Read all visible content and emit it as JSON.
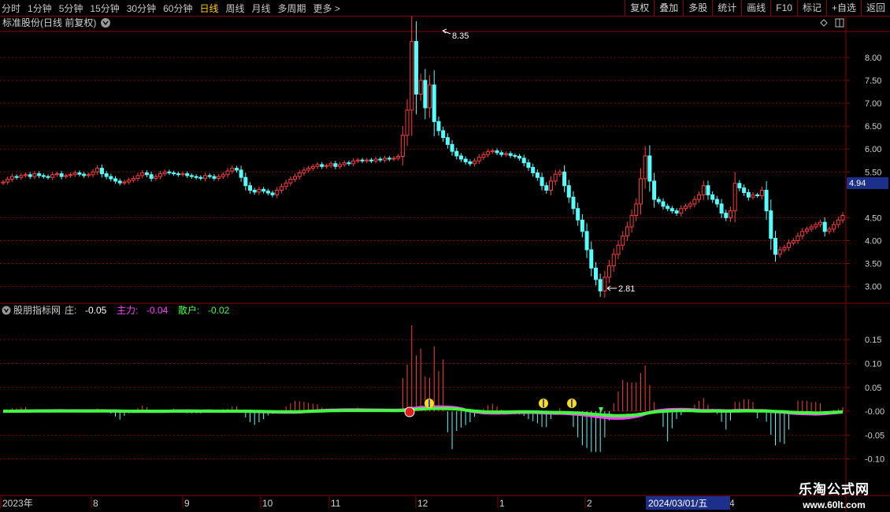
{
  "toolbar": {
    "periods": [
      "分时",
      "1分钟",
      "5分钟",
      "15分钟",
      "30分钟",
      "60分钟",
      "日线",
      "周线",
      "月线",
      "多周期",
      "更多 >"
    ],
    "active_period": "日线",
    "actions": [
      "复权",
      "叠加",
      "多股",
      "统计",
      "画线",
      "F10",
      "标记",
      "+自选",
      "返回"
    ]
  },
  "main_panel": {
    "title": "标准股份(日线 前复权)",
    "price_axis": [
      "8.00",
      "7.50",
      "7.00",
      "6.50",
      "6.00",
      "5.50",
      "4.50",
      "4.00",
      "3.50",
      "3.00"
    ],
    "current_price": "4.94",
    "high_label": "8.35",
    "low_label": "2.81"
  },
  "indicator_panel": {
    "name": "股朋指标网",
    "items": [
      {
        "label": "庄:",
        "value": "-0.05",
        "color": "#ffffff"
      },
      {
        "label": "主力:",
        "value": "-0.04",
        "color": "#ff40ff"
      },
      {
        "label": "散户:",
        "value": "-0.02",
        "color": "#40ff40"
      }
    ],
    "axis": [
      "0.15",
      "0.10",
      "0.05",
      "-0.00",
      "-0.05",
      "-0.10"
    ]
  },
  "time_axis": {
    "labels": [
      "2023年",
      "8",
      "9",
      "10",
      "11",
      "12",
      "1",
      "2",
      "4"
    ],
    "cursor_date": "2024/03/01/五"
  },
  "watermark": {
    "line1": "乐淘公式网",
    "line2": "www.60lt.com"
  },
  "colors": {
    "up": "#ff3c3c",
    "down": "#54ffff",
    "grid": "#8b0000",
    "zhuli": "#ff40ff",
    "sanhu": "#40ff40"
  },
  "chart_data": {
    "type": "candlestick",
    "price_range": [
      2.7,
      8.55
    ],
    "closes": [
      5.28,
      5.34,
      5.4,
      5.38,
      5.42,
      5.44,
      5.4,
      5.46,
      5.42,
      5.4,
      5.38,
      5.44,
      5.46,
      5.4,
      5.42,
      5.44,
      5.48,
      5.45,
      5.42,
      5.44,
      5.5,
      5.58,
      5.46,
      5.4,
      5.35,
      5.3,
      5.26,
      5.28,
      5.32,
      5.36,
      5.42,
      5.48,
      5.44,
      5.36,
      5.4,
      5.46,
      5.5,
      5.48,
      5.46,
      5.44,
      5.46,
      5.42,
      5.4,
      5.38,
      5.36,
      5.42,
      5.4,
      5.36,
      5.4,
      5.44,
      5.52,
      5.58,
      5.54,
      5.38,
      5.2,
      5.1,
      5.06,
      5.12,
      5.08,
      5.04,
      5.0,
      5.1,
      5.18,
      5.26,
      5.34,
      5.4,
      5.48,
      5.54,
      5.58,
      5.62,
      5.66,
      5.62,
      5.64,
      5.68,
      5.62,
      5.66,
      5.7,
      5.68,
      5.74,
      5.76,
      5.74,
      5.76,
      5.74,
      5.78,
      5.76,
      5.8,
      5.78,
      5.8,
      5.84,
      6.3,
      6.85,
      8.35,
      7.2,
      7.5,
      6.9,
      7.4,
      6.6,
      6.4,
      6.25,
      6.1,
      5.95,
      5.85,
      5.78,
      5.72,
      5.68,
      5.74,
      5.82,
      5.88,
      5.94,
      5.96,
      5.92,
      5.88,
      5.9,
      5.86,
      5.84,
      5.8,
      5.7,
      5.6,
      5.48,
      5.38,
      5.2,
      5.1,
      5.3,
      5.45,
      5.5,
      5.2,
      4.95,
      4.7,
      4.45,
      4.2,
      3.8,
      3.4,
      3.15,
      2.9,
      3.2,
      3.45,
      3.7,
      3.9,
      4.1,
      4.3,
      4.55,
      4.8,
      5.35,
      5.85,
      5.3,
      4.9,
      4.85,
      4.75,
      4.7,
      4.65,
      4.6,
      4.7,
      4.75,
      4.8,
      4.9,
      5.0,
      5.2,
      5.0,
      4.9,
      4.8,
      4.6,
      4.5,
      4.65,
      5.25,
      5.15,
      5.05,
      4.95,
      5.0,
      4.98,
      5.1,
      4.65,
      4.05,
      3.7,
      3.8,
      3.85,
      3.95,
      4.0,
      4.1,
      4.2,
      4.25,
      4.3,
      4.35,
      4.4,
      4.2,
      4.25,
      4.35,
      4.45,
      4.55
    ]
  }
}
